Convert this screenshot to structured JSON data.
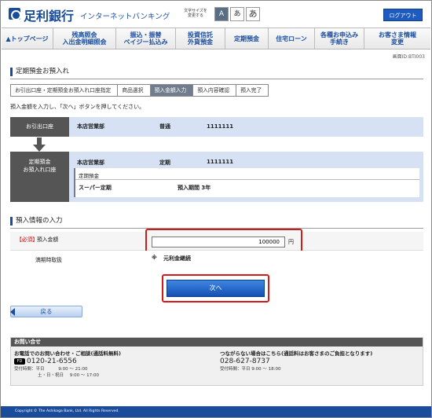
{
  "header": {
    "bank_name": "足利銀行",
    "service": "インターネットバンキング",
    "font_size_label": "文字サイズを変更する",
    "font_size_options": [
      "A",
      "あ",
      "あ"
    ],
    "logout": "ログアウト"
  },
  "nav": {
    "items": [
      {
        "id": "top",
        "label": "▲トップページ"
      },
      {
        "id": "balance",
        "label": "残高照会\n入出金明細照会"
      },
      {
        "id": "transfer",
        "label": "振込・振替\nペイジー払込み"
      },
      {
        "id": "fund",
        "label": "投資信託\n外貨預金"
      },
      {
        "id": "time-deposit",
        "label": "定期預金"
      },
      {
        "id": "housing-loan",
        "label": "住宅ローン"
      },
      {
        "id": "applications",
        "label": "各種お申込み\n手続き"
      },
      {
        "id": "customer-info",
        "label": "お客さま情報\n変更"
      }
    ]
  },
  "screen_id": "画面ID:BTI003",
  "page_title": "定期預金お預入れ",
  "steps": [
    {
      "label": "お引出口座・定期預金お預入れ口座指定",
      "active": false
    },
    {
      "label": "商品選択",
      "active": false
    },
    {
      "label": "預入金額入力",
      "active": true
    },
    {
      "label": "預入内容確認",
      "active": false
    },
    {
      "label": "預入完了",
      "active": false
    }
  ],
  "instruction": "預入金額を入力し、「次へ」ボタンを押してください。",
  "from_account": {
    "header": "お引出口座",
    "branch": "本店営業部",
    "type": "普通",
    "number": "1111111"
  },
  "to_account": {
    "header_line1": "定期預金",
    "header_line2": "お預入れ口座",
    "branch": "本店営業部",
    "type": "定期",
    "number": "1111111",
    "sub_label": "定期預金",
    "product": "スーパー定期",
    "term": "預入期間 3年"
  },
  "deposit_info": {
    "title": "預入情報の入力",
    "required": "【必須】",
    "amount_label": "預入金額",
    "amount_value": "100000",
    "amount_unit": "円",
    "maturity_label": "満期時取扱",
    "maturity_marker": "※",
    "maturity_value": "元利金継続"
  },
  "buttons": {
    "next": "次へ",
    "back": "戻る"
  },
  "inquiry": {
    "title": "お問い合せ",
    "left_heading": "お電話でのお問い合わせ・ご相談(通話料無料)",
    "free_dial_icon": "free-dial-icon",
    "free_dial_mark": "FD",
    "phone": "0120-21-6556",
    "hours_label": "受付時間：",
    "weekday": "平日",
    "weekday_hours": "9:00 ～ 21:00",
    "weekend": "土・日・祝日",
    "weekend_hours": "9:00 ～ 17:00",
    "right_heading": "つながらない場合はこちら(通話料はお客さまのご負担となります)",
    "alt_phone": "028-627-8737",
    "alt_hours": "受付時間：平日 9:00 ～ 18:00"
  },
  "footer": "Copyright © The Ashikaga Bank, Ltd. All Rights Reserved.",
  "colors": {
    "brand": "#1a4c9c",
    "highlight": "#d21a1a",
    "row_bg": "#d6e2f3",
    "header_cell": "#555555"
  }
}
